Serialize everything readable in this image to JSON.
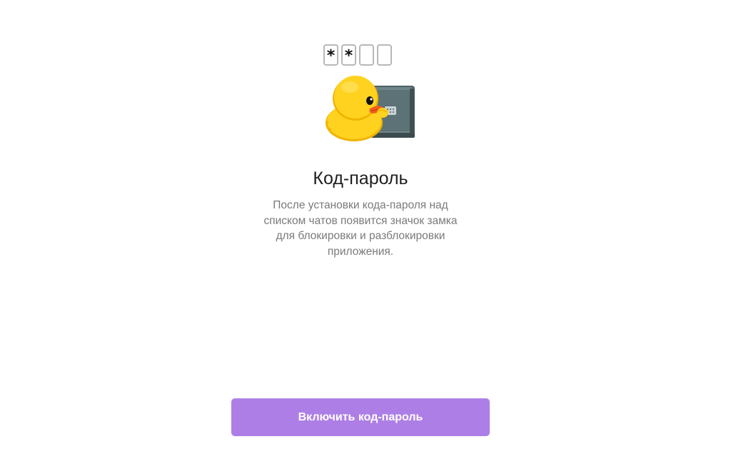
{
  "passcode_screen": {
    "pin_preview": [
      "*",
      "*",
      "",
      ""
    ],
    "title": "Код-пароль",
    "description": "После установки кода-пароля над списком чатов появится значок замка для блокировки и разблокировки приложения.",
    "enable_button_label": "Включить код-пароль",
    "sticker_icon": "duck-with-safe-icon"
  },
  "colors": {
    "accent": "#ad7fe6",
    "title": "#1f1f1f",
    "description": "#7a7a7a",
    "duck": "#ffd21f",
    "safe": "#5f7478"
  }
}
